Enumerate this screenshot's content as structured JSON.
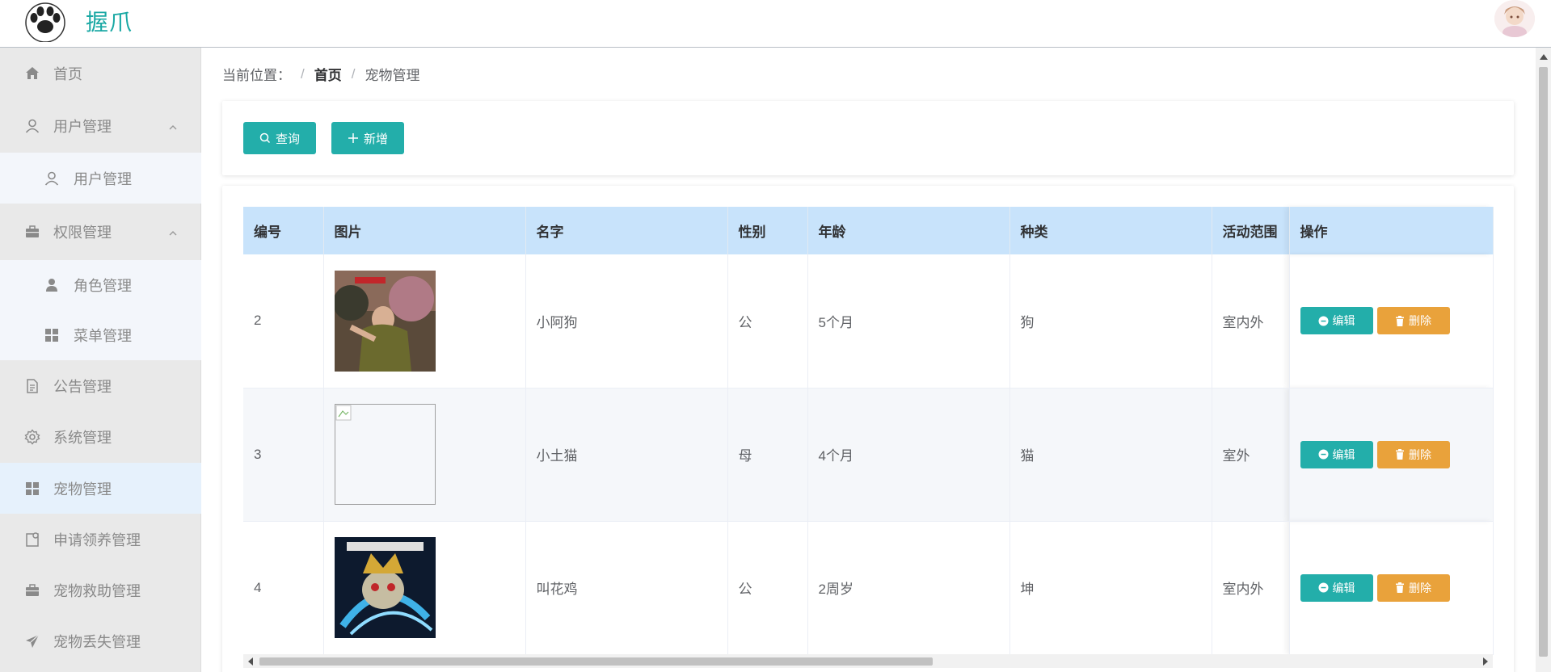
{
  "header": {
    "brand": "握爪"
  },
  "sidebar": {
    "items": [
      {
        "label": "首页",
        "icon": "home-icon"
      },
      {
        "label": "用户管理",
        "icon": "user-icon"
      },
      {
        "label": "用户管理",
        "icon": "user-icon"
      },
      {
        "label": "权限管理",
        "icon": "briefcase-icon"
      },
      {
        "label": "角色管理",
        "icon": "person-icon"
      },
      {
        "label": "菜单管理",
        "icon": "grid-icon"
      },
      {
        "label": "公告管理",
        "icon": "document-icon"
      },
      {
        "label": "系统管理",
        "icon": "gear-icon"
      },
      {
        "label": "宠物管理",
        "icon": "grid-icon"
      },
      {
        "label": "申请领养管理",
        "icon": "notebook-icon"
      },
      {
        "label": "宠物救助管理",
        "icon": "briefcase-icon"
      },
      {
        "label": "宠物丢失管理",
        "icon": "send-icon"
      }
    ]
  },
  "breadcrumb": {
    "prefix": "当前位置：",
    "separator": "/",
    "home": "首页",
    "current": "宠物管理"
  },
  "toolbar": {
    "search_label": "查询",
    "add_label": "新增"
  },
  "table": {
    "headers": [
      "编号",
      "图片",
      "名字",
      "性别",
      "年龄",
      "种类",
      "活动范围",
      "操作"
    ],
    "rows": [
      {
        "id": "2",
        "name": "小阿狗",
        "gender": "公",
        "age": "5个月",
        "kind": "狗",
        "range": "室内外"
      },
      {
        "id": "3",
        "name": "小土猫",
        "gender": "母",
        "age": "4个月",
        "kind": "猫",
        "range": "室外"
      },
      {
        "id": "4",
        "name": "叫花鸡",
        "gender": "公",
        "age": "2周岁",
        "kind": "坤",
        "range": "室内外"
      }
    ],
    "edit_label": "编辑",
    "delete_label": "删除"
  },
  "colors": {
    "primary": "#23aeaa",
    "warning": "#e9a23b",
    "header_bg": "#c8e3fb",
    "sidebar_bg": "#e9e9e9"
  }
}
